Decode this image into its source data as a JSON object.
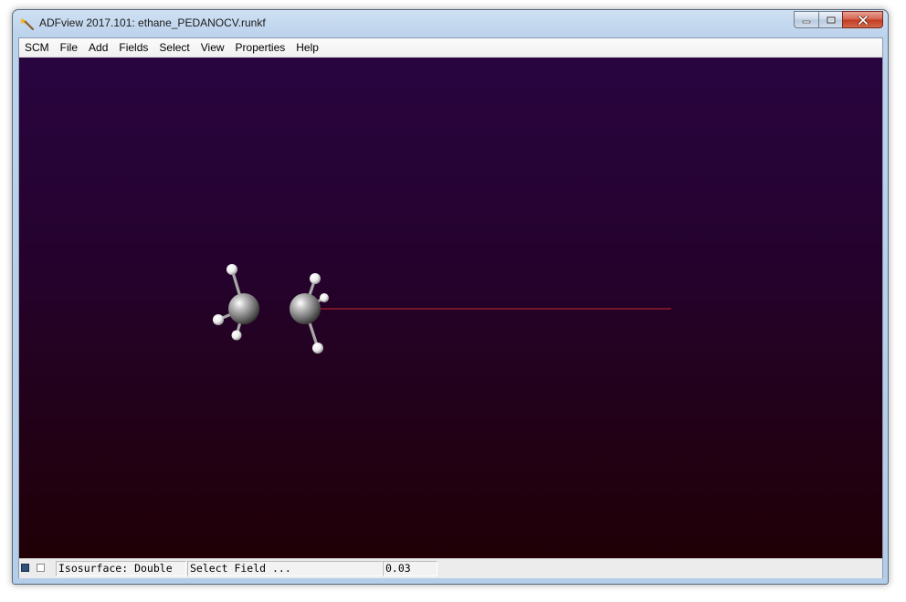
{
  "window": {
    "title": "ADFview 2017.101: ethane_PEDANOCV.runkf",
    "app_icon": "adfview-wand-icon",
    "controls": {
      "minimize_icon": "minimize-icon",
      "maximize_icon": "maximize-icon",
      "close_icon": "close-icon"
    }
  },
  "menu": {
    "items": [
      {
        "id": "scm",
        "label": "SCM"
      },
      {
        "id": "file",
        "label": "File"
      },
      {
        "id": "add",
        "label": "Add"
      },
      {
        "id": "fields",
        "label": "Fields"
      },
      {
        "id": "select",
        "label": "Select"
      },
      {
        "id": "view",
        "label": "View"
      },
      {
        "id": "properties",
        "label": "Properties"
      },
      {
        "id": "help",
        "label": "Help"
      }
    ]
  },
  "viewport": {
    "background_top": "#290540",
    "background_bottom": "#200006",
    "molecule": {
      "name": "ethane",
      "carbon_color": "#8a8a8a",
      "hydrogen_color": "#f2f2f2",
      "bond_color": "#b0b0b0",
      "axis_line_color": "#c62828"
    }
  },
  "statusbar": {
    "color_square": "#2f4f7f",
    "checkbox_checked": false,
    "isosurface": "Isosurface: Double",
    "field": "Select Field ...",
    "value": "0.03"
  }
}
